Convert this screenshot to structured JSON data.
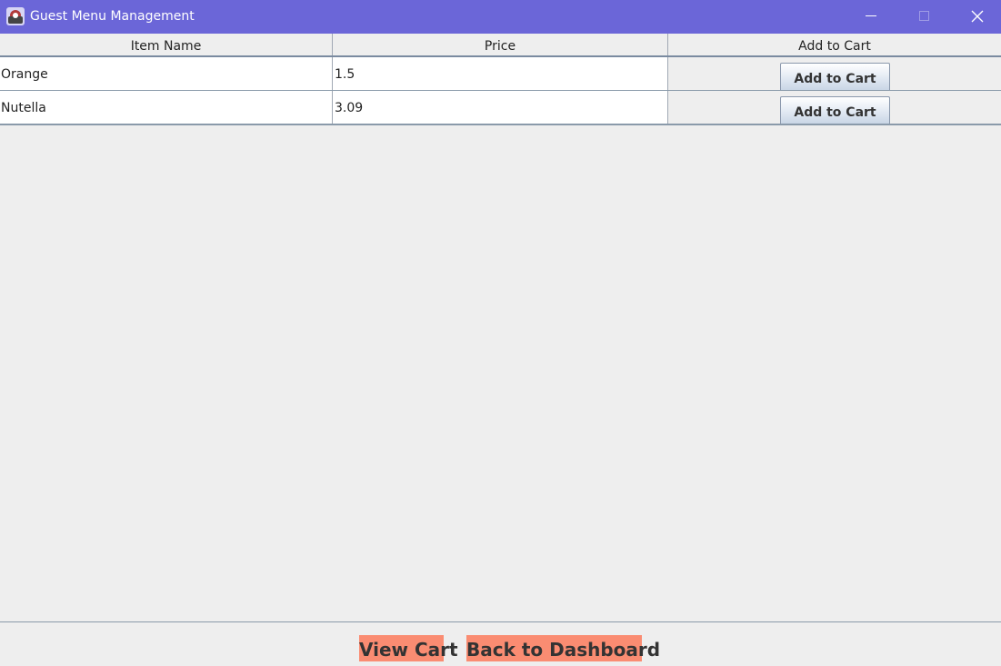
{
  "window": {
    "title": "Guest Menu Management",
    "icons": {
      "app": "app-icon",
      "minimize": "minimize-icon",
      "maximize": "maximize-icon",
      "close": "close-icon"
    },
    "titlebar_color": "#6b66d8"
  },
  "table": {
    "headers": [
      "Item Name",
      "Price",
      "Add to Cart"
    ],
    "rows": [
      {
        "name": "Orange",
        "price": "1.5",
        "action": "Add to Cart"
      },
      {
        "name": "Nutella",
        "price": "3.09",
        "action": "Add to Cart"
      }
    ]
  },
  "footer": {
    "view_cart": "View Cart",
    "back_dashboard": "Back to Dashboard",
    "button_color": "#fa8c72"
  }
}
